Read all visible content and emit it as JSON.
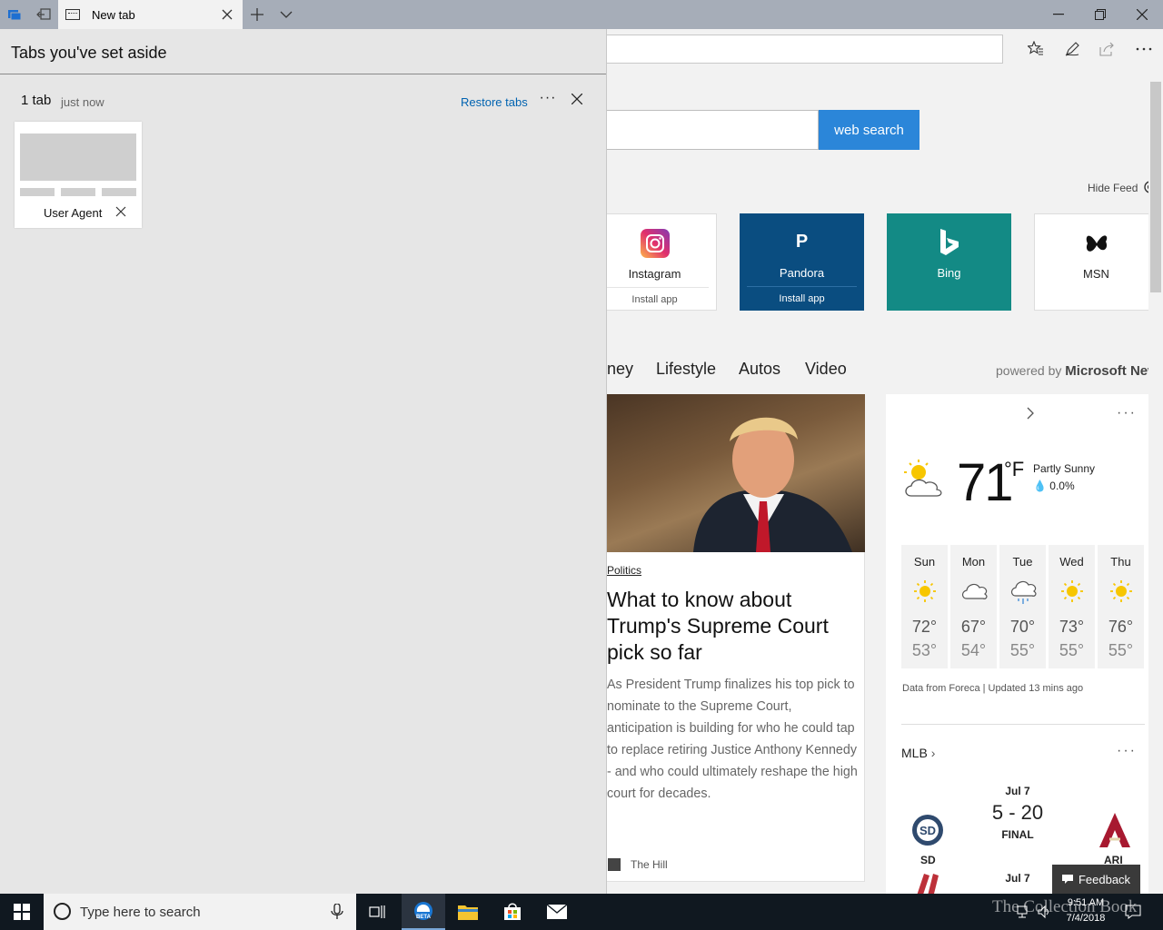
{
  "tabbar": {
    "tab_title": "New tab"
  },
  "aside": {
    "title": "Tabs you've set aside",
    "group_count": "1 tab",
    "group_time": "just now",
    "restore_label": "Restore tabs",
    "more_label": "···",
    "card_label": "User Agent"
  },
  "browser": {
    "search_button": "web search",
    "hide_feed": "Hide Feed",
    "tiles": [
      {
        "name": "Instagram",
        "install": "Install app"
      },
      {
        "name": "Pandora",
        "install": "Install app",
        "letter": "P"
      },
      {
        "name": "Bing"
      },
      {
        "name": "MSN"
      }
    ],
    "nav_categories": [
      "ney",
      "Lifestyle",
      "Autos",
      "Video"
    ],
    "powered_prefix": "powered by",
    "powered_brand": "Microsoft New",
    "article": {
      "category": "Politics",
      "title": "What to know about Trump's Supreme Court pick so far",
      "summary": "As President Trump finalizes his top pick to nominate to the Supreme Court, anticipation is building for who he could tap to replace retiring Justice Anthony Kennedy - and who could ultimately reshape the high court for decades.",
      "source": "The Hill"
    },
    "weather": {
      "temp": "71",
      "unit": "°F",
      "condition": "Partly Sunny",
      "precip": "0.0%",
      "days": [
        {
          "name": "Sun",
          "hi": "72°",
          "lo": "53°",
          "icon": "sun-icon"
        },
        {
          "name": "Mon",
          "hi": "67°",
          "lo": "54°",
          "icon": "cloud-icon"
        },
        {
          "name": "Tue",
          "hi": "70°",
          "lo": "55°",
          "icon": "rain-cloud-icon"
        },
        {
          "name": "Wed",
          "hi": "73°",
          "lo": "55°",
          "icon": "sun-icon"
        },
        {
          "name": "Thu",
          "hi": "76°",
          "lo": "55°",
          "icon": "sun-icon"
        }
      ],
      "source": "Data from Foreca | Updated 13 mins ago"
    },
    "mlb": {
      "title": "MLB",
      "game_date": "Jul 7",
      "score": "5 - 20",
      "status": "FINAL",
      "home": "SD",
      "away": "ARI",
      "next_date": "Jul 7"
    },
    "feedback": "Feedback"
  },
  "taskbar": {
    "search_placeholder": "Type here to search",
    "time": "9:51 AM",
    "date": "7/4/2018",
    "watermark": "The Collection Book"
  },
  "colors": {
    "accent": "#2b86d9",
    "pandora": "#0a4d80",
    "bing": "#138a85",
    "link": "#0063b1"
  }
}
